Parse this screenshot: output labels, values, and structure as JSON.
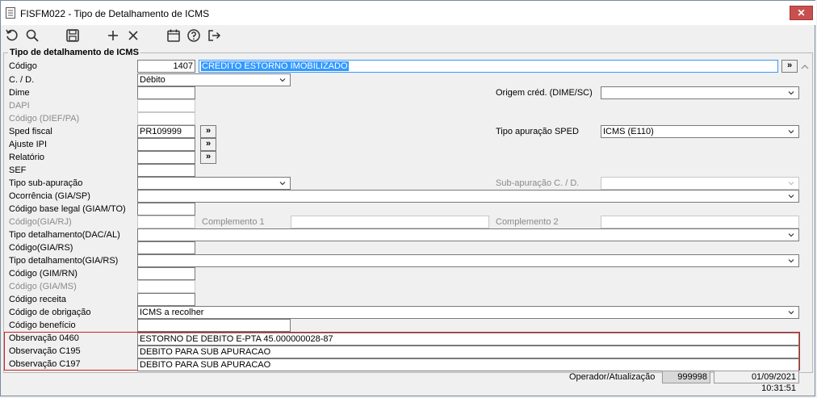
{
  "window": {
    "title": "FISFM022 - Tipo de Detalhamento de ICMS",
    "close_label": "✕"
  },
  "toolbar": {
    "icons": [
      "undo-icon",
      "search-icon",
      "save-icon",
      "add-icon",
      "delete-icon",
      "calendar-icon",
      "help-icon",
      "exit-icon"
    ]
  },
  "group": {
    "title": "Tipo de detalhamento de ICMS"
  },
  "form": {
    "codigo_label": "Código",
    "codigo_value": "1407",
    "descricao_value": "CREDITO ESTORNO IMOBILIZADO",
    "cd_label": "C. / D.",
    "cd_value": "Débito",
    "dime_label": "Dime",
    "dapi_label": "DAPI",
    "codigo_dief_label": "Código (DIEF/PA)",
    "sped_label": "Sped fiscal",
    "sped_value": "PR109999",
    "ajuste_ipi_label": "Ajuste IPI",
    "relatorio_label": "Relatório",
    "sef_label": "SEF",
    "tipo_sub_label": "Tipo sub-apuração",
    "ocorrencia_label": "Ocorrência (GIA/SP)",
    "cod_base_legal_label": "Código base legal (GIAM/TO)",
    "codigo_giarj_label": "Código(GIA/RJ)",
    "complemento1_label": "Complemento 1",
    "complemento2_label": "Complemento 2",
    "tipo_dac_label": "Tipo detalhamento(DAC/AL)",
    "codigo_giars_label": "Código(GIA/RS)",
    "tipo_giars_label": "Tipo detalhamento(GIA/RS)",
    "codigo_gimrn_label": "Código (GIM/RN)",
    "codigo_giams_label": "Código (GIA/MS)",
    "codigo_receita_label": "Código receita",
    "cod_obrigacao_label": "Código de obrigação",
    "cod_obrigacao_value": "ICMS a recolher",
    "cod_beneficio_label": "Código benefício",
    "origem_label": "Origem créd. (DIME/SC)",
    "tipo_apuracao_label": "Tipo apuração SPED",
    "tipo_apuracao_value": "ICMS (E110)",
    "sub_apuracao_cd_label": "Sub-apuração C. / D.",
    "obs0460_label": "Observação 0460",
    "obs0460_value": "ESTORNO DE DEBITO E-PTA 45.000000028-87",
    "obsc195_label": "Observação C195",
    "obsc195_value": "DEBITO PARA SUB APURACAO",
    "obsc197_label": "Observação C197",
    "obsc197_value": "DEBITO PARA SUB APURACAO",
    "lookup_label": "»"
  },
  "status": {
    "operador_label": "Operador/Atualização",
    "operador_value": "999998",
    "data_value": "01/09/2021 10:31:51"
  }
}
